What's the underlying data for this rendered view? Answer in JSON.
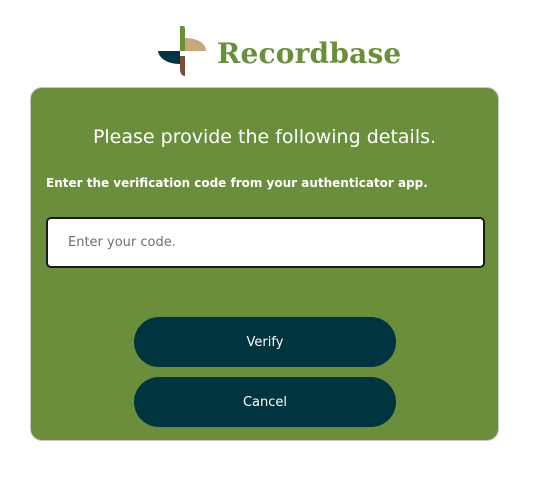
{
  "brand": {
    "name": "Recordbase",
    "logo_icon": "recordbase-logo-icon",
    "colors": {
      "green": "#6b8e3d",
      "dark_teal": "#00343f",
      "tan": "#c9a77c",
      "brown": "#7a4a3a"
    }
  },
  "form": {
    "title": "Please provide the following details.",
    "instruction": "Enter the verification code from your authenticator app.",
    "code_input": {
      "value": "",
      "placeholder": "Enter your code."
    },
    "verify_label": "Verify",
    "cancel_label": "Cancel",
    "background_color": "#6b8e3d",
    "button_color": "#00343f"
  }
}
